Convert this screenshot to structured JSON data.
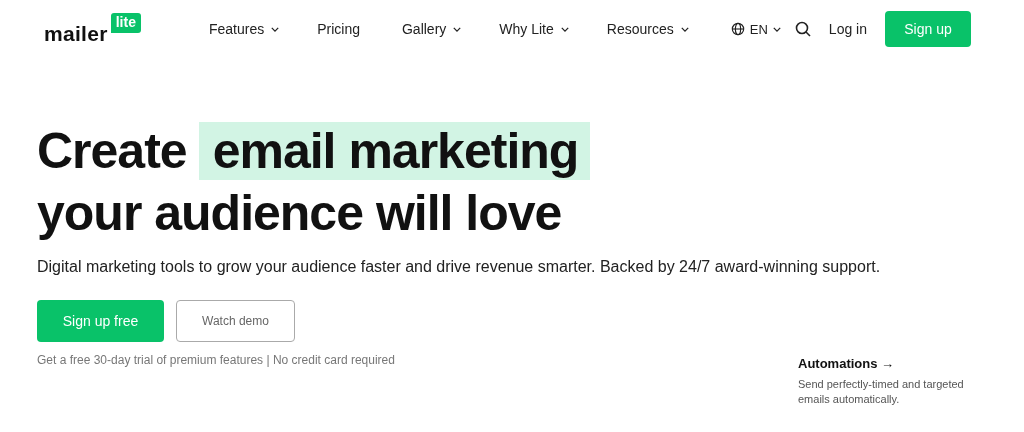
{
  "logo": {
    "word": "mailer",
    "badge": "lite"
  },
  "nav": [
    {
      "label": "Features",
      "dropdown": true
    },
    {
      "label": "Pricing",
      "dropdown": false
    },
    {
      "label": "Gallery",
      "dropdown": true
    },
    {
      "label": "Why Lite",
      "dropdown": true
    },
    {
      "label": "Resources",
      "dropdown": true
    }
  ],
  "language": {
    "label": "EN"
  },
  "login": "Log in",
  "signup": "Sign up",
  "hero": {
    "lead": "Create",
    "highlight": "email marketing",
    "line2": "your audience will love",
    "subtitle": "Digital marketing tools to grow your audience faster and drive revenue smarter. Backed by 24/7 award-winning support.",
    "primary": "Sign up free",
    "secondary": "Watch demo",
    "note": "Get a free 30-day trial of premium features | No credit card required"
  },
  "feature": {
    "title": "Automations",
    "arrow": "→",
    "description": "Send perfectly-timed and targeted emails automatically."
  }
}
